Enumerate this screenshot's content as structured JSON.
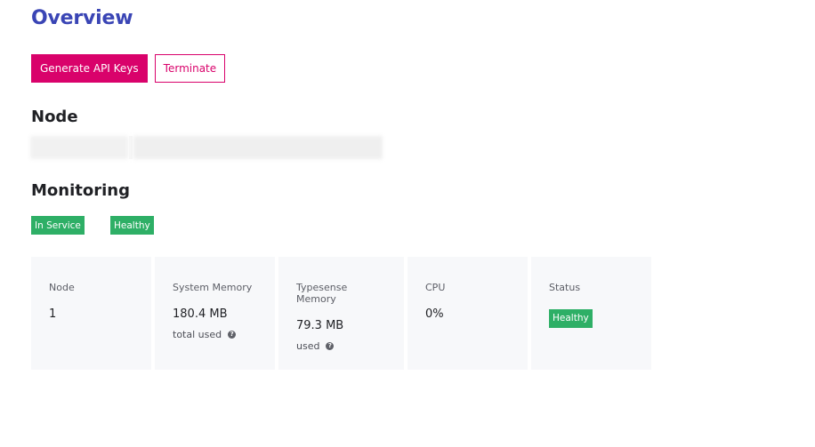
{
  "page": {
    "title": "Overview"
  },
  "actions": {
    "generate_keys_label": "Generate API Keys",
    "terminate_label": "Terminate"
  },
  "colors": {
    "accent": "#d9026b",
    "title": "#3a45b5",
    "success": "#2eaf66"
  },
  "node_section": {
    "heading": "Node",
    "redacted": true
  },
  "monitoring": {
    "heading": "Monitoring",
    "badges": [
      "In Service",
      "Healthy"
    ],
    "cards": [
      {
        "label": "Node",
        "value": "1"
      },
      {
        "label": "System Memory",
        "value": "180.4 MB",
        "sub": "total used",
        "help_icon": "question-circle-icon"
      },
      {
        "label": "Typesense Memory",
        "value": "79.3 MB",
        "sub": "used",
        "help_icon": "question-circle-icon"
      },
      {
        "label": "CPU",
        "value": "0%"
      },
      {
        "label": "Status",
        "badge": "Healthy"
      }
    ]
  }
}
